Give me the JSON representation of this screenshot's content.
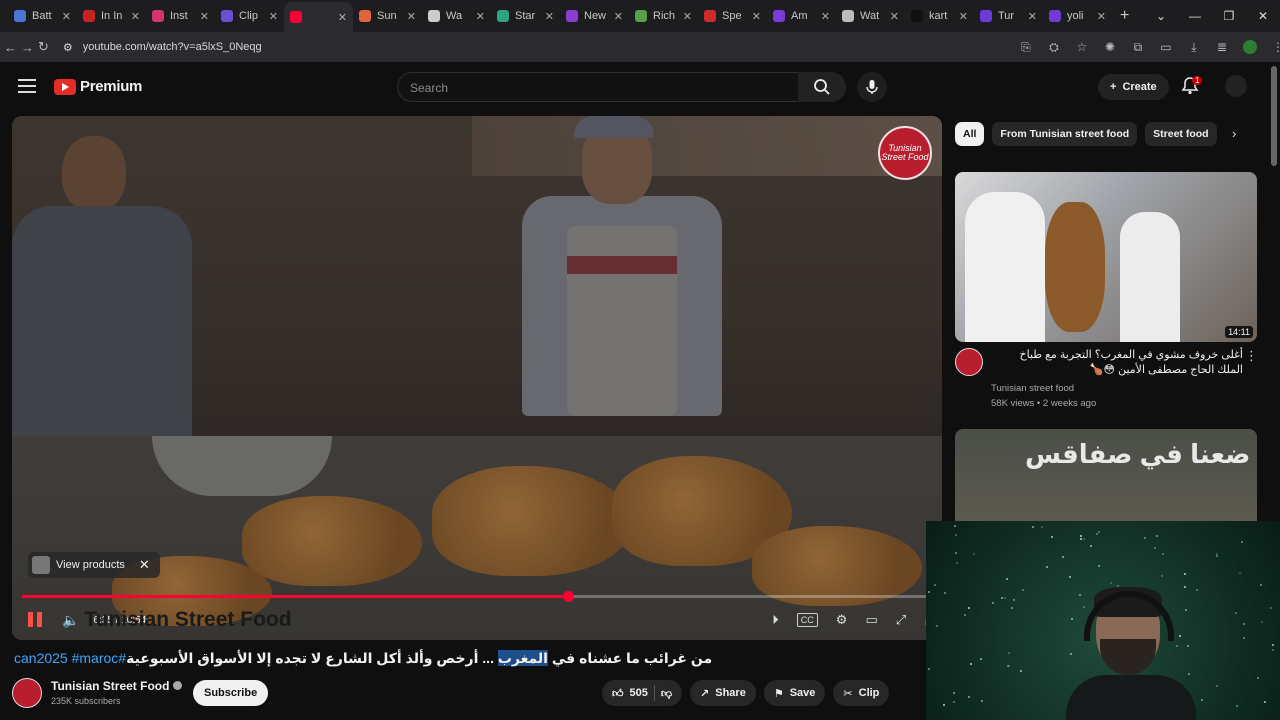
{
  "browser": {
    "tabs": [
      {
        "label": "Batt",
        "color": "#4a76d9"
      },
      {
        "label": "In In",
        "color": "#cc2222"
      },
      {
        "label": "Inst",
        "color": "#d6336c"
      },
      {
        "label": "Clip",
        "color": "#6b4fd8"
      },
      {
        "label": "",
        "color": "#ff0033",
        "active": true
      },
      {
        "label": "Sun",
        "color": "#e2643c"
      },
      {
        "label": "Wa",
        "color": "#cccccc"
      },
      {
        "label": "Star",
        "color": "#2fa37f"
      },
      {
        "label": "New",
        "color": "#8b3dd6"
      },
      {
        "label": "Rich",
        "color": "#5aa04a"
      },
      {
        "label": "Spe",
        "color": "#d22a2a"
      },
      {
        "label": "Am",
        "color": "#7a3bd6"
      },
      {
        "label": "Wat",
        "color": "#bbbbbb"
      },
      {
        "label": "kart",
        "color": "#111111"
      },
      {
        "label": "Tur",
        "color": "#6a3bd6"
      },
      {
        "label": "yoli",
        "color": "#6a3bd6"
      }
    ],
    "url": "youtube.com/watch?v=a5lxS_0Neqg"
  },
  "header": {
    "logo_text": "Premium",
    "search_placeholder": "Search",
    "create_label": "Create",
    "notification_count": "1"
  },
  "player": {
    "channel_logo_text": "Tunisian Street Food",
    "view_products_label": "View products",
    "watermark_text": "Tunisian Street Food",
    "time_display": "6:35 / 10:54",
    "progress_fraction": 0.6
  },
  "video": {
    "title_part1": "من غرائب ما عشناه في ",
    "title_highlight": "المغرب",
    "title_part2": " ... أرخص وألذ أكل الشارع لا تجده إلا الأسواق الأسبوعية",
    "hashtags": "#can2025 #maroc",
    "channel_name": "Tunisian Street Food",
    "subscribers": "235K subscribers",
    "subscribe_label": "Subscribe",
    "likes": "505",
    "share_label": "Share",
    "save_label": "Save",
    "clip_label": "Clip"
  },
  "sidebar": {
    "chips": [
      {
        "label": "All",
        "selected": true
      },
      {
        "label": "From Tunisian street food",
        "selected": false
      },
      {
        "label": "Street food",
        "selected": false
      }
    ],
    "rec1": {
      "title": "أغلى خروف مشوي في المغرب؟ التجربة مع طباخ الملك الحاج مصطفى الأمين 😳🍗",
      "channel": "Tunisian street food",
      "stats": "58K views • 2 weeks ago",
      "duration": "14:11"
    },
    "rec2": {
      "thumb_text": "ضعنا في صفاقس"
    }
  }
}
